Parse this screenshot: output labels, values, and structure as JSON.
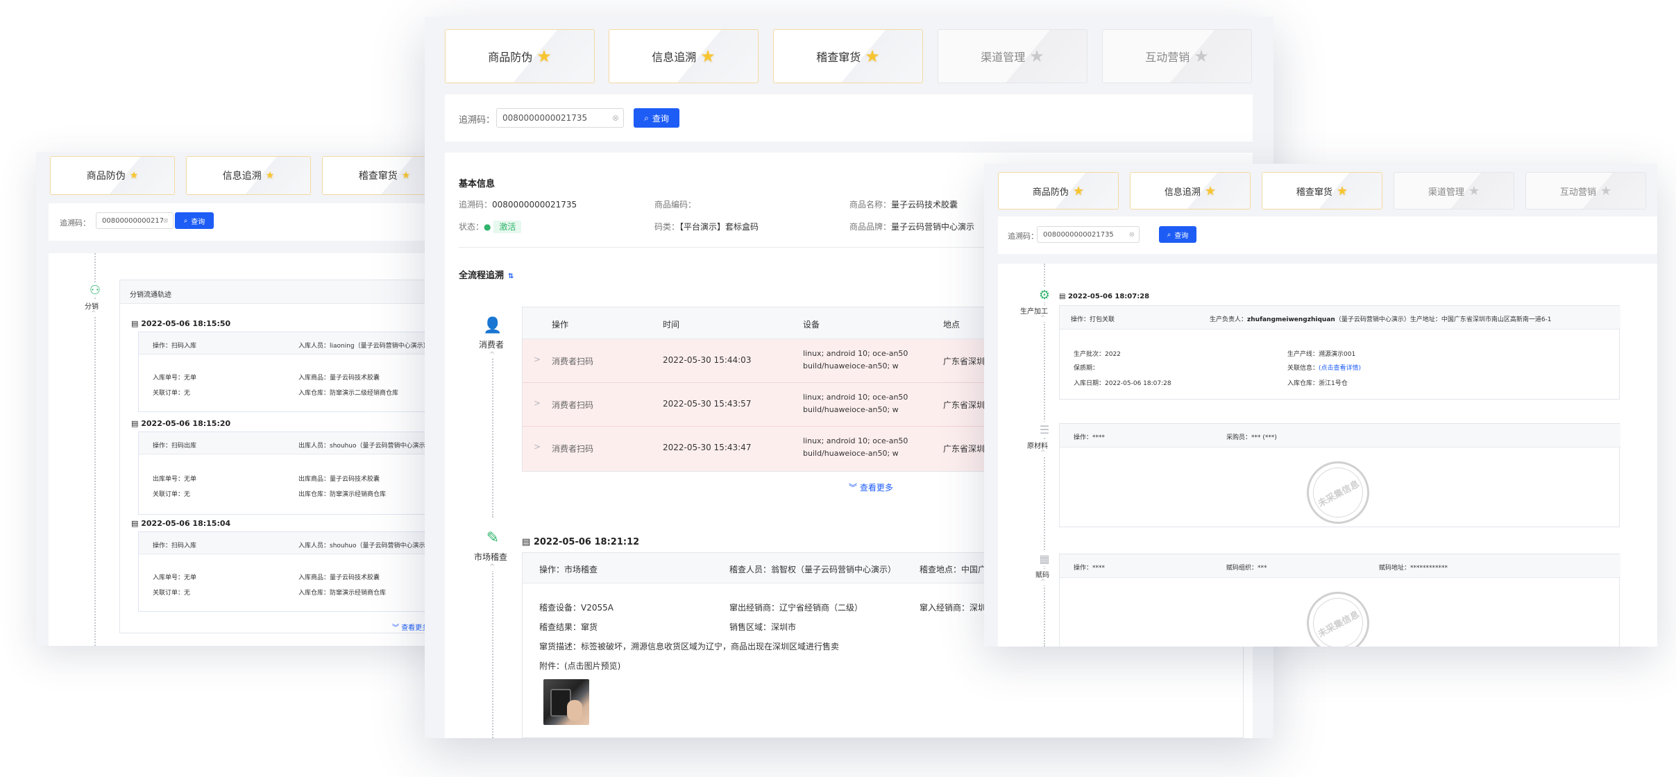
{
  "tabs": {
    "anti_fake": "商品防伪",
    "trace": "信息追溯",
    "inspect": "稽查窜货",
    "channel": "渠道管理",
    "marketing": "互动营销"
  },
  "search": {
    "label": "追溯码：",
    "value": "0080000000021735",
    "button": "查询"
  },
  "left": {
    "node_label": "分销",
    "panel_title": "分销流通轨迹",
    "records": [
      {
        "time": "2022-05-06 18:15:50",
        "op": "操作：扫码入库",
        "person": "入库人员：liaoning（量子云码营销中心演示）",
        "f1": "入库单号：无单",
        "f2": "入库商品：量子云码技术胶囊",
        "f3": "关联订单：无",
        "f4": "入库仓库：防窜演示二级经销商仓库"
      },
      {
        "time": "2022-05-06 18:15:20",
        "op": "操作：扫码出库",
        "person": "出库人员：shouhuo（量子云码营销中心演示）",
        "f1": "出库单号：无单",
        "f2": "出库商品：量子云码技术胶囊",
        "f3": "关联订单：无",
        "f4": "出库仓库：防窜演示经销商仓库"
      },
      {
        "time": "2022-05-06 18:15:04",
        "op": "操作：扫码入库",
        "person": "入库人员：shouhuo（量子云码营销中心演示）",
        "f1": "入库单号：无单",
        "f2": "入库商品：量子云码技术胶囊",
        "f3": "关联订单：无",
        "f4": "入库仓库：防窜演示经销商仓库"
      }
    ],
    "more": "查看更多"
  },
  "center": {
    "basic_title": "基本信息",
    "code_label": "追溯码：",
    "code_value": "0080000000021735",
    "goods_code_label": "商品编码：",
    "goods_name_label": "商品名称：",
    "goods_name_value": "量子云码技术胶囊",
    "status_label": "状态：",
    "status_value": "激活",
    "code_type_label": "码类：",
    "code_type_value": "【平台演示】套标盒码",
    "brand_label": "商品品牌：",
    "brand_value": "量子云码营销中心演示",
    "flow_title": "全流程追溯",
    "consumer_label": "消费者",
    "table_headers": [
      "操作",
      "时间",
      "设备",
      "地点"
    ],
    "rows": [
      {
        "op": "消费者扫码",
        "time": "2022-05-30 15:44:03",
        "device1": "linux; android 10; oce-an50",
        "device2": "build/huaweioce-an50; w",
        "place": "广东省深圳"
      },
      {
        "op": "消费者扫码",
        "time": "2022-05-30 15:43:57",
        "device1": "linux; android 10; oce-an50",
        "device2": "build/huaweioce-an50; w",
        "place": "广东省深圳"
      },
      {
        "op": "消费者扫码",
        "time": "2022-05-30 15:43:47",
        "device1": "linux; android 10; oce-an50",
        "device2": "build/huaweioce-an50; w",
        "place": "广东省深圳"
      }
    ],
    "more": "查看更多",
    "market_label": "市场稽查",
    "inspect_time": "2022-05-06 18:21:12",
    "inspect_op": "操作：市场稽查",
    "inspector": "稽查人员：翁智权（量子云码营销中心演示）",
    "inspect_place": "稽查地点：中国广",
    "inspect_device": "稽查设备：V2055A",
    "out_dealer": "窜出经销商：辽宁省经销商（二级）",
    "in_dealer": "窜入经销商：深圳",
    "result": "稽查结果：窜货",
    "sale_area": "销售区域：深圳市",
    "desc": "窜货描述：标签被破坏，溯源信息收货区域为辽宁，商品出现在深圳区域进行售卖",
    "attach": "附件：(点击图片预览)"
  },
  "right": {
    "node_prod": "生产加工",
    "node_material": "原材料",
    "node_code": "赋码",
    "prod_time": "2022-05-06 18:07:28",
    "prod_op": "操作：打包关联",
    "prod_person": "生产负责人：",
    "prod_person_name": "zhufangmeiwengzhiquan",
    "prod_person_rest": "（量子云码营销中心演示）生产地址：中国广东省深圳市南山区高新南一道6-1",
    "batch": "生产批次：2022",
    "line": "生产产线：溯源演示001",
    "shelf": "保质期：",
    "rel_label": "关联信息：",
    "rel_link": "(点击查看详情)",
    "in_date": "入库日期：2022-05-06 18:07:28",
    "in_wh": "入库仓库：浙江1号仓",
    "mat_op": "操作：****",
    "mat_buyer": "采购员：*** (***)",
    "stamp": "未采集信息",
    "code_op": "操作：****",
    "code_org": "赋码组织：***",
    "code_addr": "赋码地址：************"
  },
  "colors": {
    "primary": "#1d5cf5",
    "star": "#f7c531",
    "active_green": "#31b46c",
    "row_pink": "#fdeeee"
  }
}
